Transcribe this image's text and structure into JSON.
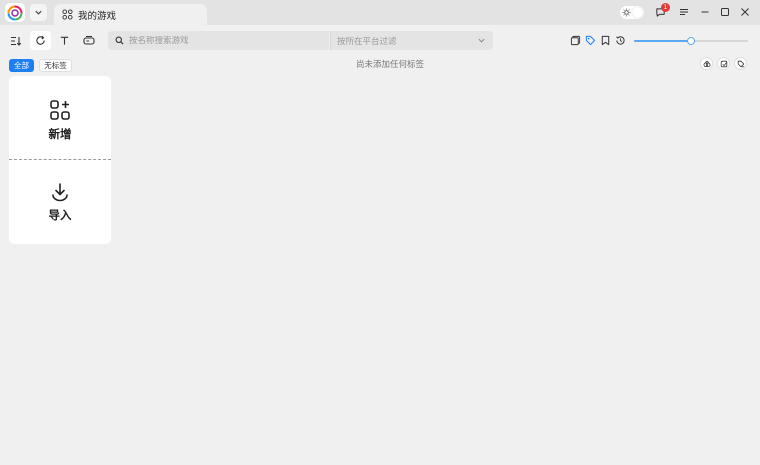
{
  "titlebar": {
    "tab_title": "我的游戏",
    "notification_count": "1"
  },
  "toolbar": {
    "search_placeholder": "按名称搜索游戏",
    "platform_filter_placeholder": "按所在平台过滤",
    "zoom_slider_level": 0.5
  },
  "tags": {
    "all_label": "全部",
    "untagged_label": "无标签",
    "empty_hint": "尚未添加任何标签"
  },
  "card": {
    "add_label": "新增",
    "import_label": "导入"
  },
  "colors": {
    "accent": "#1e80f0",
    "slider": "#5aa9f2",
    "badge": "#e53935"
  },
  "icons": {
    "logo": "app-logo-icon",
    "tab": "grid-icon",
    "search": "search-icon",
    "add": "apps-add-icon",
    "import": "download-icon"
  }
}
